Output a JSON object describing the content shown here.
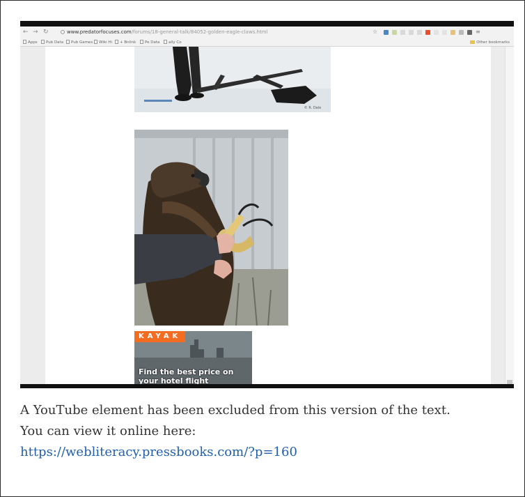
{
  "browser": {
    "address_host": "www.predatorfocuses.com",
    "address_path": "/forums/18-general-talk/84052-golden-eagle-claws.html",
    "bookmarks": [
      "Apps",
      "Pub Data",
      "Pub Games",
      "Wiki Hi",
      "+ Bnlink",
      "Pe Data",
      "ally Co"
    ],
    "other_bookmarks": "Other bookmarks"
  },
  "page": {
    "image1_credit": "© R. Dale",
    "ad": {
      "brand": "KAYAK",
      "text": "Find the best price on your hotel flight"
    }
  },
  "caption": {
    "line1": "A YouTube element has been excluded from this version of the text.",
    "line2": "You can view it online here:",
    "link": "https://webliteracy.pressbooks.com/?p=160"
  },
  "colors": {
    "link": "#1f5fae",
    "kayak_orange": "#f26d22"
  }
}
